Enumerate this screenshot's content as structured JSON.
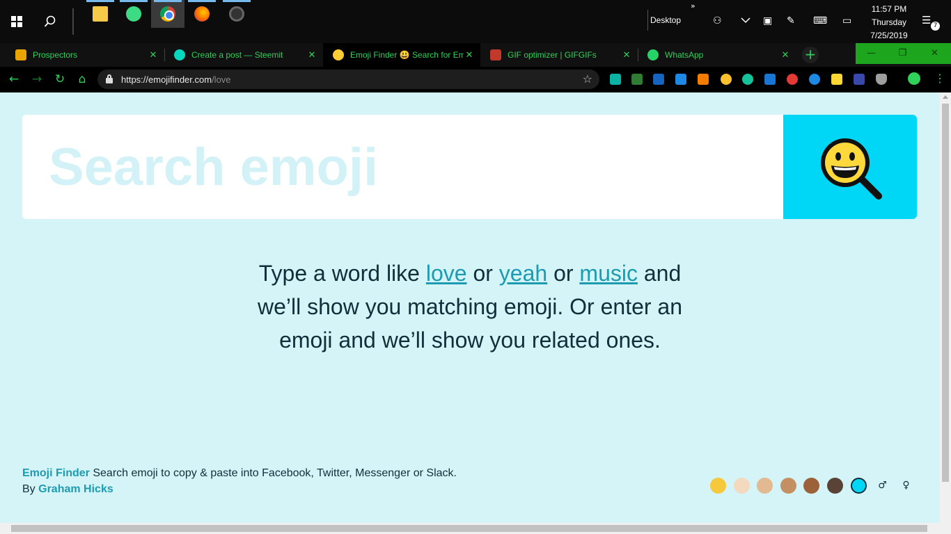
{
  "taskbar": {
    "apps": [
      {
        "name": "File Explorer",
        "icon": "folder-icon"
      },
      {
        "name": "Android Studio",
        "icon": "android-icon"
      },
      {
        "name": "Google Chrome",
        "icon": "chrome-icon"
      },
      {
        "name": "Firefox",
        "icon": "firefox-icon"
      },
      {
        "name": "OBS",
        "icon": "obs-icon"
      }
    ],
    "toolbar_label": "Desktop",
    "chevrons": "»",
    "clock": {
      "time": "11:57 PM",
      "day": "Thursday",
      "date": "7/25/2019"
    },
    "notification_count": "7"
  },
  "browser": {
    "tabs": [
      {
        "title": "Prospectors",
        "active": false,
        "icon_color": "#e9a400"
      },
      {
        "title": "Create a post — Steemit",
        "active": false,
        "icon_color": "#07d6c0"
      },
      {
        "title": "Emoji Finder 😃 Search for Em",
        "active": true,
        "icon_color": "#ffcc33"
      },
      {
        "title": "GIF optimizer | GIFGIFs",
        "active": false,
        "icon_color": "#c0392b"
      },
      {
        "title": "WhatsApp",
        "active": false,
        "icon_color": "#25d366"
      }
    ],
    "new_tab": "+",
    "window_controls": {
      "minimize": "—",
      "restore": "❐",
      "close": "✕"
    },
    "url": {
      "host": "https://emojifinder.com",
      "path": "/love"
    }
  },
  "page": {
    "search": {
      "placeholder": "Search emoji",
      "value": ""
    },
    "intro": {
      "before": "Type a word like ",
      "link1": "love",
      "sep1": " or ",
      "link2": "yeah",
      "sep2": " or ",
      "link3": "music",
      "after": " and we’ll show you matching emoji. Or enter an emoji and we’ll show you related ones."
    },
    "footer": {
      "brand": "Emoji Finder",
      "tagline": " Search emoji to copy & paste into Facebook, Twitter, Messenger or Slack.",
      "by": "By ",
      "author": "Graham Hicks"
    },
    "skin_tones": [
      "#f6c83c",
      "#f3d9bd",
      "#e2b991",
      "#c58f64",
      "#9c6138",
      "#5b4237"
    ],
    "selected_tone_color": "#00d6f5",
    "gender_options": [
      "♂",
      "♀"
    ],
    "colors": {
      "background": "#d4f4f8",
      "accent": "#00d6f5",
      "link": "#1d9bb0",
      "text": "#0f2f3a"
    }
  }
}
